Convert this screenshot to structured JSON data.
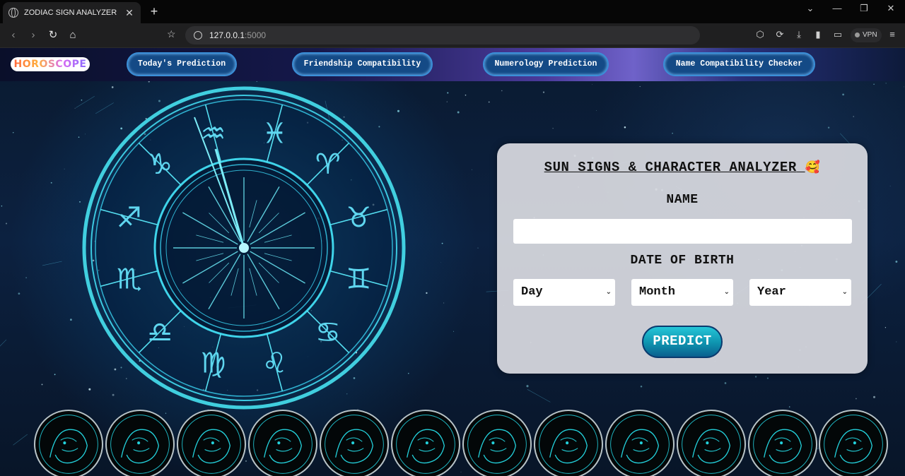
{
  "browser": {
    "tab_title": "ZODIAC SIGN ANALYZER",
    "url_host": "127.0.0.1",
    "url_port": ":5000",
    "vpn_label": "VPN"
  },
  "navbar": {
    "logo_text": "HOROSCOPE",
    "links": [
      "Today's Prediction",
      "Friendship Compatibility",
      "Numerology Prediction",
      "Name Compatibility Checker"
    ]
  },
  "form": {
    "title": "SUN SIGNS & CHARACTER ANALYZER",
    "title_emoji": "🥰",
    "name_label": "NAME",
    "name_value": "",
    "dob_label": "DATE OF BIRTH",
    "day_selected": "Day",
    "month_selected": "Month",
    "year_selected": "Year",
    "predict_label": "PREDICT"
  },
  "wheel_signs": [
    "♒",
    "♓",
    "♈",
    "♉",
    "♊",
    "♋",
    "♌",
    "♍",
    "♎",
    "♏",
    "♐",
    "♑"
  ],
  "medallions": [
    "aries",
    "taurus",
    "gemini",
    "cancer",
    "leo",
    "virgo",
    "libra",
    "scorpio",
    "sagittarius",
    "capricorn",
    "aquarius",
    "pisces"
  ],
  "colors": {
    "accent": "#1aa7c0",
    "nav_button": "#144a86",
    "card": "#d7d8de"
  }
}
